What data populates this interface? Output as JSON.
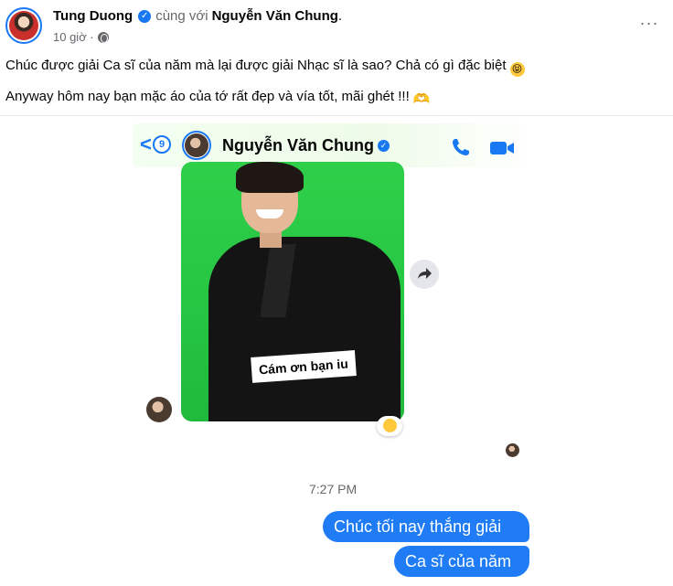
{
  "post": {
    "author_name": "Tung Duong",
    "with_text": "cùng với",
    "tagged_name": "Nguyễn Văn Chung",
    "period": ".",
    "timestamp": "10 giờ ·",
    "more_label": "···",
    "caption_line_1": "Chúc được giải Ca sĩ của năm mà lại được giải Nhạc sĩ là sao? Chả có gì đặc biệt",
    "caption_line_2": "Anyway hôm nay bạn mặc áo của tớ rất đẹp và vía tốt, mãi ghét !!!",
    "emoji_1": "😝",
    "emoji_2": "🫶"
  },
  "chat": {
    "back_label": "<",
    "unread_count": "9",
    "contact_name": "Nguyễn Văn Chung",
    "photo_sticker_text": "Cám ơn bạn iu",
    "time_label": "7:27 PM",
    "messages": [
      {
        "text": "Chúc tối nay thắng giải"
      },
      {
        "text": "Ca sĩ của năm"
      }
    ]
  },
  "colors": {
    "accent": "#1877f2",
    "bubble": "#1f7cf5",
    "photo_background": "#27c744",
    "muted_text": "#65676b"
  },
  "icons": {
    "verified": "verified-badge-icon",
    "globe": "globe-icon",
    "phone": "phone-icon",
    "video": "video-camera-icon",
    "forward": "forward-arrow-icon"
  }
}
